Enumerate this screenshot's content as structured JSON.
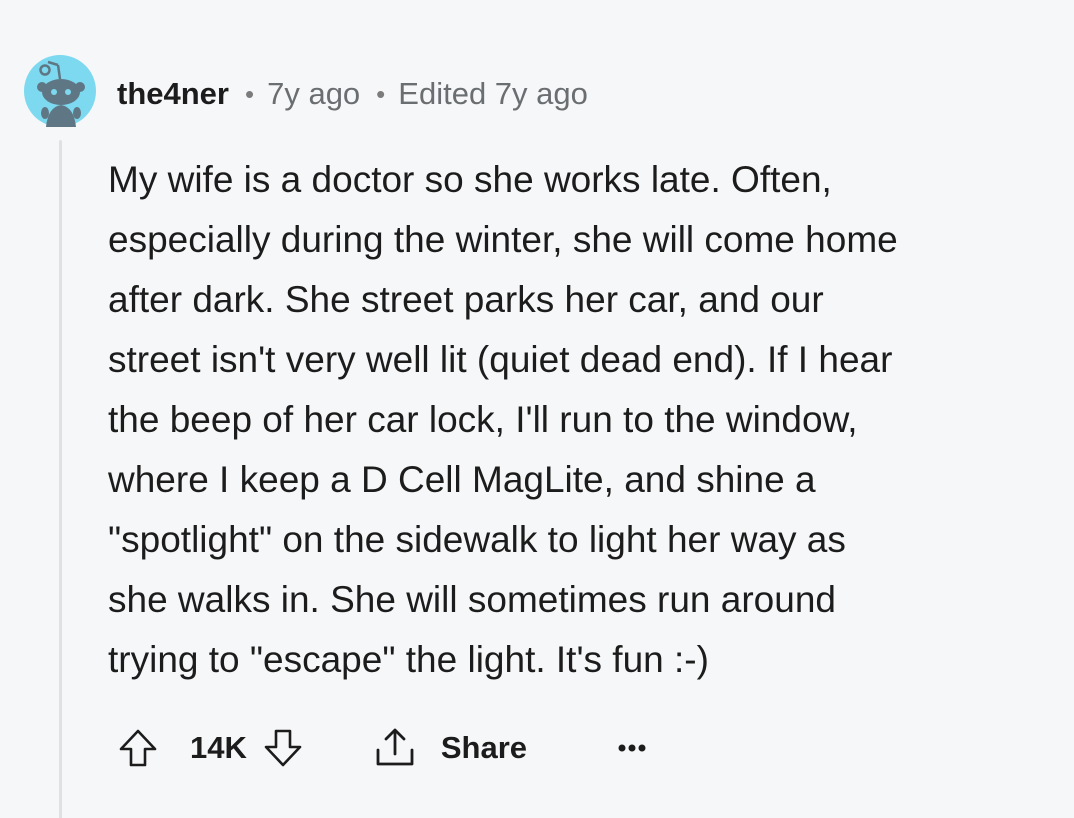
{
  "comment": {
    "username": "the4ner",
    "separator": "•",
    "posted": "7y ago",
    "edited": "Edited 7y ago",
    "body_lines": [
      "My wife is a doctor so she works late. Often,",
      "especially during the winter, she will come home",
      "after dark. She street parks her car, and our",
      "street isn't very well lit (quiet dead end). If I hear",
      "the beep of her car lock, I'll run to the window,",
      "where I keep a D Cell MagLite, and shine a",
      "\"spotlight\" on the sidewalk to light her way as",
      "she walks in. She will sometimes run around",
      "trying to \"escape\" the light. It's fun :-)"
    ],
    "score": "14K",
    "share_label": "Share"
  },
  "colors": {
    "background": "#f6f7f8",
    "avatar_bg": "#7dd9ef",
    "text": "#1c1c1c",
    "meta": "#6a6e71",
    "thread_line": "#dfe1e3"
  },
  "icons": {
    "avatar": "snoo-avatar-icon",
    "upvote": "upvote-arrow-icon",
    "downvote": "downvote-arrow-icon",
    "share": "share-icon",
    "more": "more-options-icon"
  }
}
